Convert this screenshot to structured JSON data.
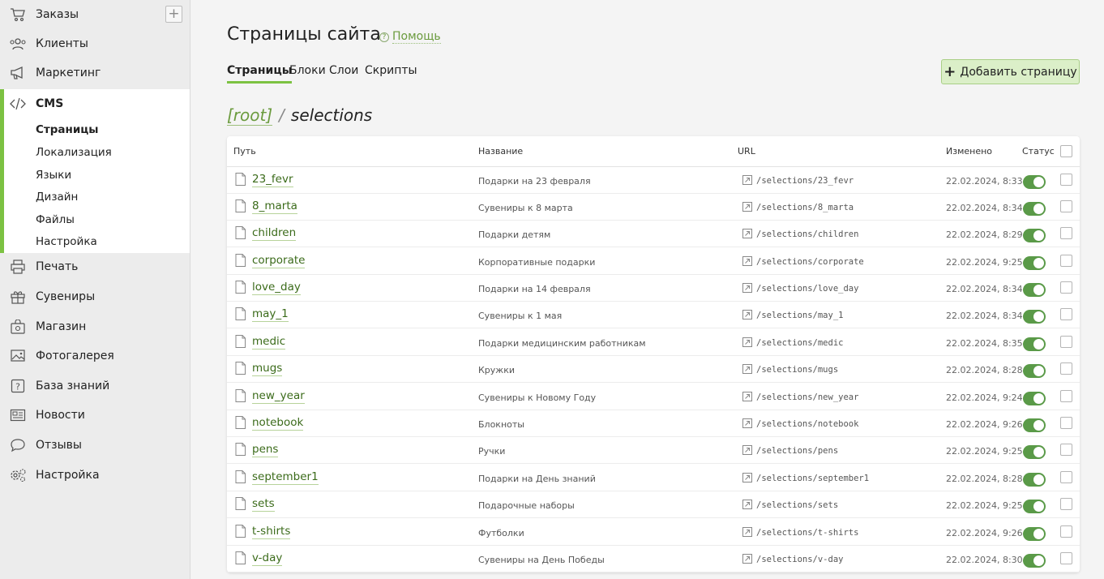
{
  "sidebar": {
    "items": [
      {
        "label": "Заказы",
        "icon": "cart-icon"
      },
      {
        "label": "Клиенты",
        "icon": "users-icon"
      },
      {
        "label": "Маркетинг",
        "icon": "megaphone-icon"
      },
      {
        "label": "CMS",
        "icon": "code-icon"
      },
      {
        "label": "Печать",
        "icon": "printer-icon"
      },
      {
        "label": "Сувениры",
        "icon": "gift-icon"
      },
      {
        "label": "Магазин",
        "icon": "shop-icon"
      },
      {
        "label": "Фотогалерея",
        "icon": "image-icon"
      },
      {
        "label": "База знаний",
        "icon": "question-icon"
      },
      {
        "label": "Новости",
        "icon": "news-icon"
      },
      {
        "label": "Отзывы",
        "icon": "chat-icon"
      },
      {
        "label": "Настройка",
        "icon": "gear-icon"
      }
    ],
    "add_label": "+",
    "cms_sub": [
      "Страницы",
      "Локализация",
      "Языки",
      "Дизайн",
      "Файлы",
      "Настройка"
    ]
  },
  "header": {
    "title": "Страницы сайта",
    "help_icon": "?",
    "help_label": "Помощь",
    "tabs": [
      "Страницы",
      "Блоки",
      "Слои",
      "Скрипты"
    ],
    "add_plus": "+",
    "add_page_label": "Добавить страницу"
  },
  "breadcrumb": {
    "root": "[root]",
    "sep": "/",
    "current": "selections"
  },
  "table": {
    "columns": [
      "Путь",
      "Название",
      "URL",
      "Изменено",
      "Статус"
    ],
    "rows": [
      {
        "path": "23_fevr",
        "title": "Подарки на 23 февраля",
        "url": "/selections/23_fevr",
        "date": "22.02.2024, 8:33",
        "active": true
      },
      {
        "path": "8_marta",
        "title": "Сувениры к 8 марта",
        "url": "/selections/8_marta",
        "date": "22.02.2024, 8:34",
        "active": true
      },
      {
        "path": "children",
        "title": "Подарки детям",
        "url": "/selections/children",
        "date": "22.02.2024, 8:29",
        "active": true
      },
      {
        "path": "corporate",
        "title": "Корпоративные подарки",
        "url": "/selections/corporate",
        "date": "22.02.2024, 9:25",
        "active": true
      },
      {
        "path": "love_day",
        "title": "Подарки на 14 февраля",
        "url": "/selections/love_day",
        "date": "22.02.2024, 8:34",
        "active": true
      },
      {
        "path": "may_1",
        "title": "Сувениры к 1 мая",
        "url": "/selections/may_1",
        "date": "22.02.2024, 8:34",
        "active": true
      },
      {
        "path": "medic",
        "title": "Подарки медицинским работникам",
        "url": "/selections/medic",
        "date": "22.02.2024, 8:35",
        "active": true
      },
      {
        "path": "mugs",
        "title": "Кружки",
        "url": "/selections/mugs",
        "date": "22.02.2024, 8:28",
        "active": true
      },
      {
        "path": "new_year",
        "title": "Сувениры к Новому Году",
        "url": "/selections/new_year",
        "date": "22.02.2024, 9:24",
        "active": true
      },
      {
        "path": "notebook",
        "title": "Блокноты",
        "url": "/selections/notebook",
        "date": "22.02.2024, 9:26",
        "active": true
      },
      {
        "path": "pens",
        "title": "Ручки",
        "url": "/selections/pens",
        "date": "22.02.2024, 9:25",
        "active": true
      },
      {
        "path": "september1",
        "title": "Подарки на День знаний",
        "url": "/selections/september1",
        "date": "22.02.2024, 8:28",
        "active": true
      },
      {
        "path": "sets",
        "title": "Подарочные наборы",
        "url": "/selections/sets",
        "date": "22.02.2024, 9:25",
        "active": true
      },
      {
        "path": "t-shirts",
        "title": "Футболки",
        "url": "/selections/t-shirts",
        "date": "22.02.2024, 9:26",
        "active": true
      },
      {
        "path": "v-day",
        "title": "Сувениры на День Победы",
        "url": "/selections/v-day",
        "date": "22.02.2024, 8:30",
        "active": true
      }
    ]
  },
  "colors": {
    "accent": "#7cc242",
    "toggle_on": "#5a9a48",
    "link": "#3b6b1a"
  }
}
